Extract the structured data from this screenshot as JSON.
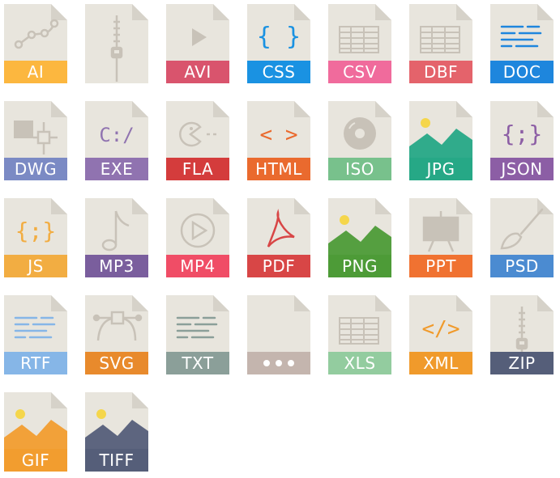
{
  "icons": [
    {
      "label": "AI",
      "color": "#fcb73f",
      "glyph": "bezier-path-icon"
    },
    {
      "label": "",
      "color": "",
      "glyph": "zipper-icon"
    },
    {
      "label": "AVI",
      "color": "#d9546d",
      "glyph": "play-icon"
    },
    {
      "label": "CSS",
      "color": "#1a92e2",
      "glyph": "curly-braces-icon"
    },
    {
      "label": "CSV",
      "color": "#f06b9c",
      "glyph": "table-grid-icon"
    },
    {
      "label": "DBF",
      "color": "#e4636b",
      "glyph": "table-grid-icon"
    },
    {
      "label": "DOC",
      "color": "#1e86dd",
      "glyph": "text-lines-icon"
    },
    {
      "label": "DWG",
      "color": "#7b8ac4",
      "glyph": "cad-node-icon"
    },
    {
      "label": "EXE",
      "color": "#9073b0",
      "glyph": "command-prompt-icon"
    },
    {
      "label": "FLA",
      "color": "#d43c3c",
      "glyph": "pacman-icon"
    },
    {
      "label": "HTML",
      "color": "#ea6a2e",
      "glyph": "angle-brackets-icon"
    },
    {
      "label": "ISO",
      "color": "#78c18c",
      "glyph": "disc-icon"
    },
    {
      "label": "JPG",
      "color": "#26a886",
      "glyph": "landscape-icon"
    },
    {
      "label": "JSON",
      "color": "#8c5ea5",
      "glyph": "curly-braces-colon-icon"
    },
    {
      "label": "JS",
      "color": "#f2ad42",
      "glyph": "curly-braces-colon-icon"
    },
    {
      "label": "MP3",
      "color": "#7a5e9d",
      "glyph": "music-note-icon"
    },
    {
      "label": "MP4",
      "color": "#f04d66",
      "glyph": "play-circle-icon"
    },
    {
      "label": "PDF",
      "color": "#d84646",
      "glyph": "acrobat-icon"
    },
    {
      "label": "PNG",
      "color": "#4d9b37",
      "glyph": "landscape-icon"
    },
    {
      "label": "PPT",
      "color": "#f07231",
      "glyph": "easel-icon"
    },
    {
      "label": "PSD",
      "color": "#4b8bd1",
      "glyph": "paintbrush-icon"
    },
    {
      "label": "RTF",
      "color": "#86b6e7",
      "glyph": "text-lines-icon"
    },
    {
      "label": "SVG",
      "color": "#e88a2c",
      "glyph": "vector-pen-icon"
    },
    {
      "label": "TXT",
      "color": "#8b9f99",
      "glyph": "text-lines-icon"
    },
    {
      "label": "",
      "color": "#c4b5ae",
      "glyph": "ellipsis-icon"
    },
    {
      "label": "XLS",
      "color": "#93cc9f",
      "glyph": "table-grid-icon"
    },
    {
      "label": "XML",
      "color": "#f09a2b",
      "glyph": "code-slash-icon"
    },
    {
      "label": "ZIP",
      "color": "#555e79",
      "glyph": "zipper-icon"
    },
    {
      "label": "GIF",
      "color": "#f29d2f",
      "glyph": "landscape-icon"
    },
    {
      "label": "TIFF",
      "color": "#555e79",
      "glyph": "landscape-icon"
    }
  ]
}
